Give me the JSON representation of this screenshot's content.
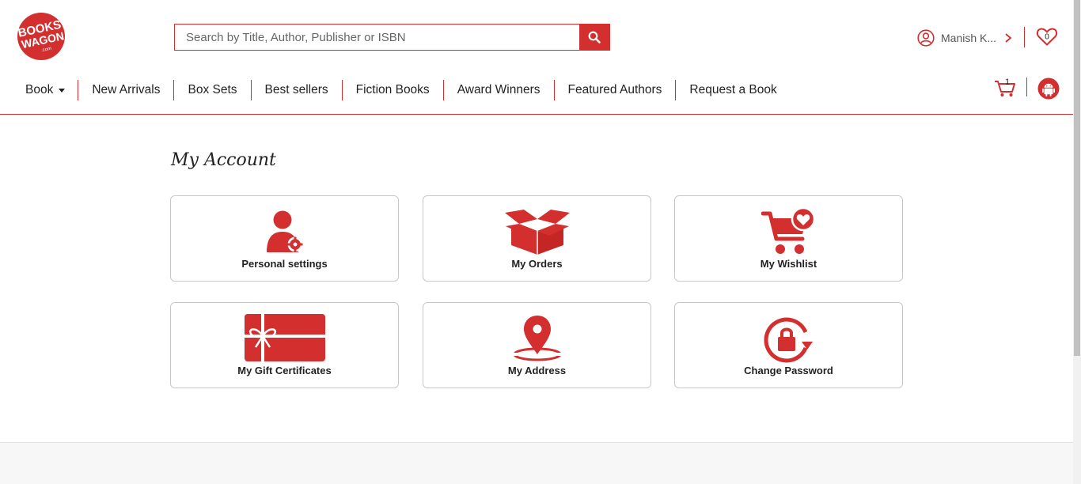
{
  "brand": {
    "logo_line1": "BOOKS",
    "logo_line2": "WAGON",
    "logo_suffix": ".com",
    "accent_color": "#d32f2f"
  },
  "search": {
    "placeholder": "Search by Title, Author, Publisher or ISBN",
    "value": "",
    "button_icon": "search-icon"
  },
  "header": {
    "user_name": "Manish K...",
    "user_icon": "user-circle-icon",
    "wishlist_count": "0",
    "cart_count": "1"
  },
  "nav": {
    "items": [
      {
        "label": "Book",
        "has_dropdown": true
      },
      {
        "label": "New Arrivals"
      },
      {
        "label": "Box Sets"
      },
      {
        "label": "Best sellers"
      },
      {
        "label": "Fiction Books"
      },
      {
        "label": "Award Winners"
      },
      {
        "label": "Featured Authors"
      },
      {
        "label": "Request a Book"
      }
    ]
  },
  "main": {
    "title": "My Account",
    "cards": [
      {
        "label": "Personal settings",
        "icon": "user-settings-icon"
      },
      {
        "label": "My Orders",
        "icon": "open-box-icon"
      },
      {
        "label": "My Wishlist",
        "icon": "cart-heart-icon"
      },
      {
        "label": "My Gift Certificates",
        "icon": "gift-card-icon"
      },
      {
        "label": "My Address",
        "icon": "map-pin-icon"
      },
      {
        "label": "Change Password",
        "icon": "lock-refresh-icon"
      }
    ]
  }
}
